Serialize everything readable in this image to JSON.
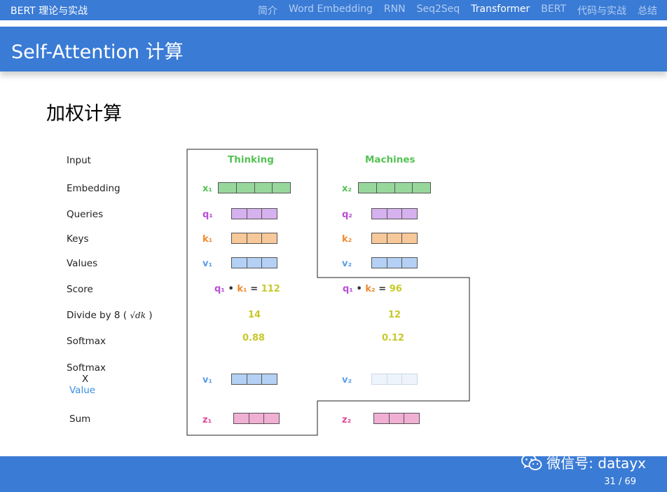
{
  "header": {
    "brand": "BERT 理论与实战",
    "nav": [
      "简介",
      "Word Embedding",
      "RNN",
      "Seq2Seq",
      "Transformer",
      "BERT",
      "代码与实战",
      "总结"
    ],
    "active_nav": "Transformer"
  },
  "slide": {
    "title": "Self-Attention 计算",
    "subtitle": "加权计算"
  },
  "figure": {
    "row_labels": {
      "input": "Input",
      "embedding": "Embedding",
      "queries": "Queries",
      "keys": "Keys",
      "values": "Values",
      "score": "Score",
      "divide_prefix": "Divide by 8 (",
      "divide_sqrt": "√dk",
      "divide_suffix": ")",
      "softmax": "Softmax",
      "softmax_x_1": "Softmax",
      "softmax_x_2": "X",
      "softmax_x_3": "Value",
      "sum": "Sum"
    },
    "word1": {
      "token": "Thinking",
      "x": "x₁",
      "q": "q₁",
      "k": "k₁",
      "v": "v₁",
      "v2": "v₁",
      "z": "z₁",
      "score_q": "q₁",
      "score_dot": "•",
      "score_k": "k₁",
      "score_eq": "=",
      "score_val": "112",
      "divided": "14",
      "softmax": "0.88"
    },
    "word2": {
      "token": "Machines",
      "x": "x₂",
      "q": "q₂",
      "k": "k₂",
      "v": "v₂",
      "v2": "v₂",
      "z": "z₂",
      "score_q": "q₁",
      "score_dot": "•",
      "score_k": "k₂",
      "score_eq": "=",
      "score_val": "96",
      "divided": "12",
      "softmax": "0.12"
    },
    "colors": {
      "green": "#55c254",
      "purple": "#b84fd6",
      "orange": "#ef8a2f",
      "blue": "#5a9ee8",
      "yellow": "#c8c82a",
      "pink": "#e0479a"
    }
  },
  "footer": {
    "wechat_text": "微信号: datayx",
    "page": "31 / 69"
  }
}
